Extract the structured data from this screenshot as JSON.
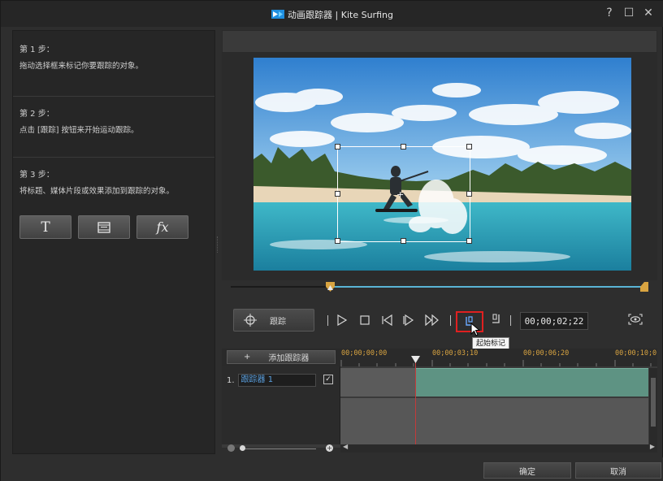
{
  "window": {
    "title": "动画跟踪器 | Kite Surfing",
    "buttons": {
      "help": "?",
      "maximize": "☐",
      "close": "✕"
    }
  },
  "steps": [
    {
      "heading": "第 1 步：",
      "text": "拖动选择框来标记你要跟踪的对象。"
    },
    {
      "heading": "第 2 步：",
      "text": "点击 [跟踪] 按钮来开始运动跟踪。"
    },
    {
      "heading": "第 3 步：",
      "text": "将标题、媒体片段或效果添加到跟踪的对象。"
    }
  ],
  "tools": {
    "title_icon": "T",
    "media_icon": "film-icon",
    "fx_icon": "fx"
  },
  "controls": {
    "track_label": "跟踪",
    "timecode": "00;00;02;22",
    "start_mark_tooltip": "起始标记"
  },
  "timeline": {
    "add_tracker_label": "添加跟踪器",
    "add_icon": "+",
    "ticks": [
      "00;00;00;00",
      "00;00;03;10",
      "00;00;06;20",
      "00;00;10;0"
    ],
    "track": {
      "index": "1.",
      "name": "跟踪器 1",
      "checked": true
    }
  },
  "footer": {
    "ok_label": "确定",
    "cancel_label": "取消"
  }
}
